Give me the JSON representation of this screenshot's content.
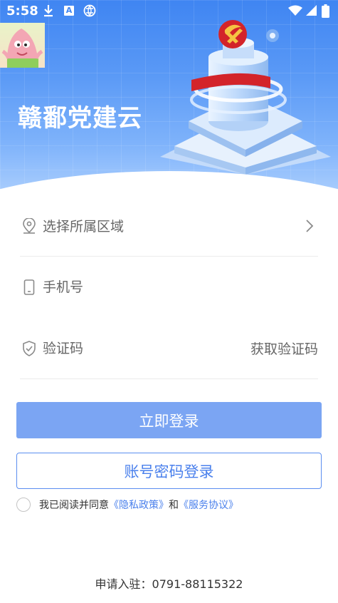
{
  "status_bar": {
    "time": "5:58"
  },
  "header": {
    "app_title": "赣鄱党建云"
  },
  "form": {
    "region": {
      "label": "选择所属区域"
    },
    "phone": {
      "placeholder": "手机号"
    },
    "code": {
      "placeholder": "验证码",
      "get_code_label": "获取验证码"
    }
  },
  "buttons": {
    "login_label": "立即登录",
    "password_login_label": "账号密码登录"
  },
  "agreement": {
    "prefix": "我已阅读并同意",
    "privacy_link": "《隐私政策》",
    "conjunction": "和",
    "service_link": "《服务协议》"
  },
  "footer": {
    "contact": "申请入驻：0791-88115322"
  },
  "colors": {
    "brand_blue": "#3f85f2",
    "primary_button": "#7ba5f3",
    "link": "#4a80ec",
    "emblem_red": "#d3242a"
  },
  "icons": {
    "status_bar": [
      "download-icon",
      "a-badge-icon",
      "globe-icon",
      "wifi-icon",
      "signal-icon",
      "battery-icon"
    ],
    "form": [
      "location-pin-icon",
      "phone-icon",
      "shield-check-icon",
      "chevron-right-icon"
    ]
  }
}
